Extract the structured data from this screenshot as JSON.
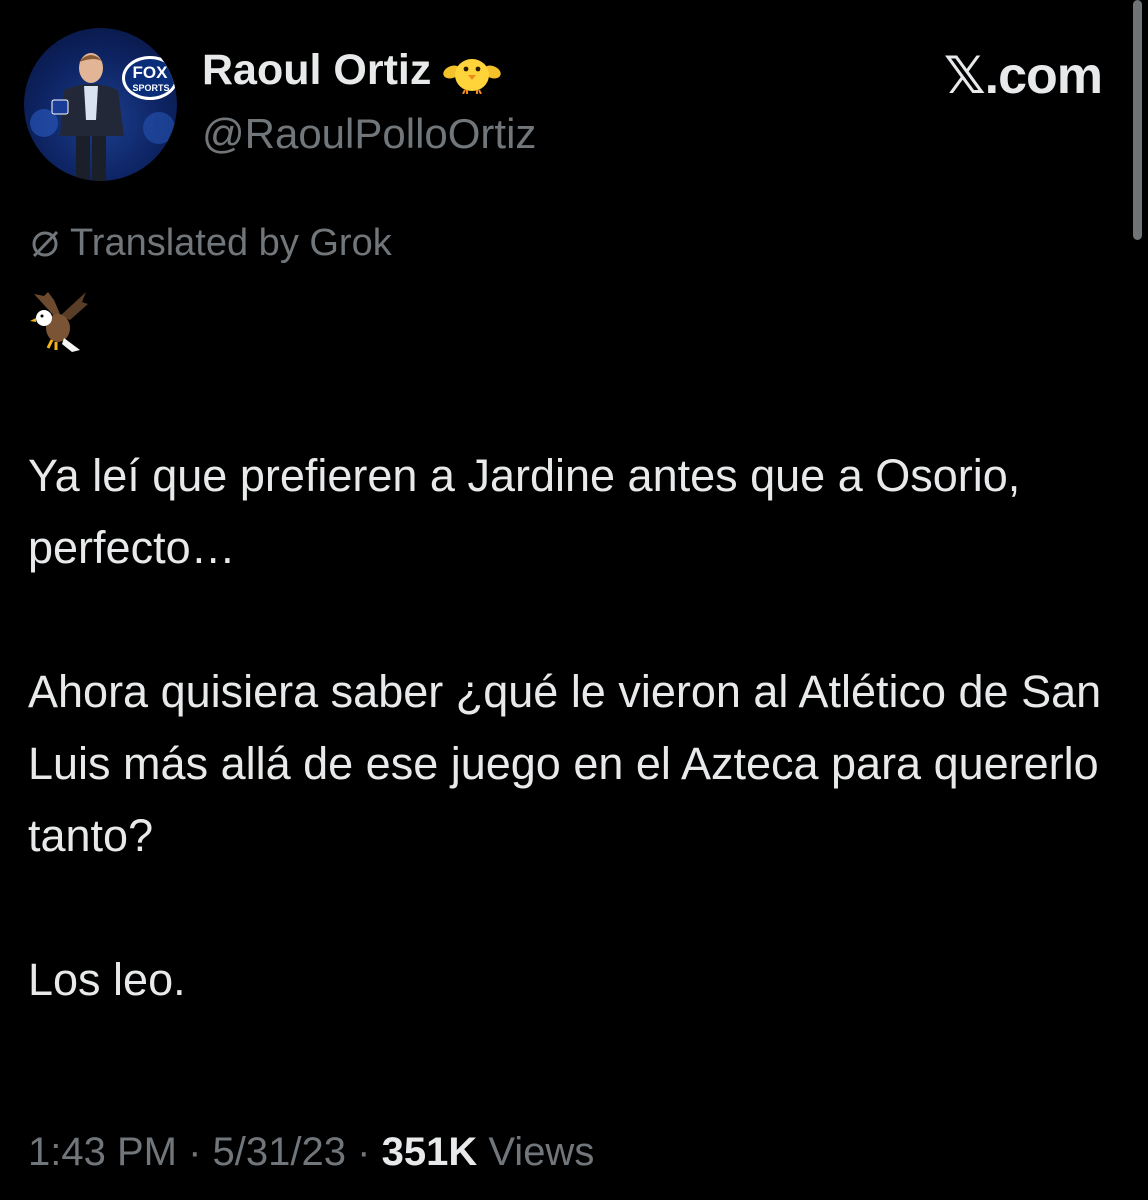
{
  "author": {
    "display_name": "Raoul Ortiz",
    "handle": "@RaoulPolloOrtiz",
    "name_emoji": "chick-emoji",
    "avatar_logo_text_line1": "FOX",
    "avatar_logo_text_line2": "SPORTS"
  },
  "brand": {
    "label": "𝕏.com"
  },
  "translation": {
    "label": "Translated by Grok",
    "icon": "grok-icon"
  },
  "tweet": {
    "leading_emoji": "eagle-emoji",
    "paragraphs": [
      "Ya leí que prefieren a Jardine antes que a Osorio, perfecto…",
      "Ahora quisiera saber ¿qué le vieron al Atlético de San Luis más allá de ese juego en el Azteca para quererlo tanto?",
      "Los leo."
    ]
  },
  "meta": {
    "time": "1:43 PM",
    "separator": "·",
    "date": "5/31/23",
    "views_count": "351K",
    "views_label": "Views"
  },
  "colors": {
    "background": "#000000",
    "primary_text": "#e7e9ea",
    "secondary_text": "#71767b"
  }
}
